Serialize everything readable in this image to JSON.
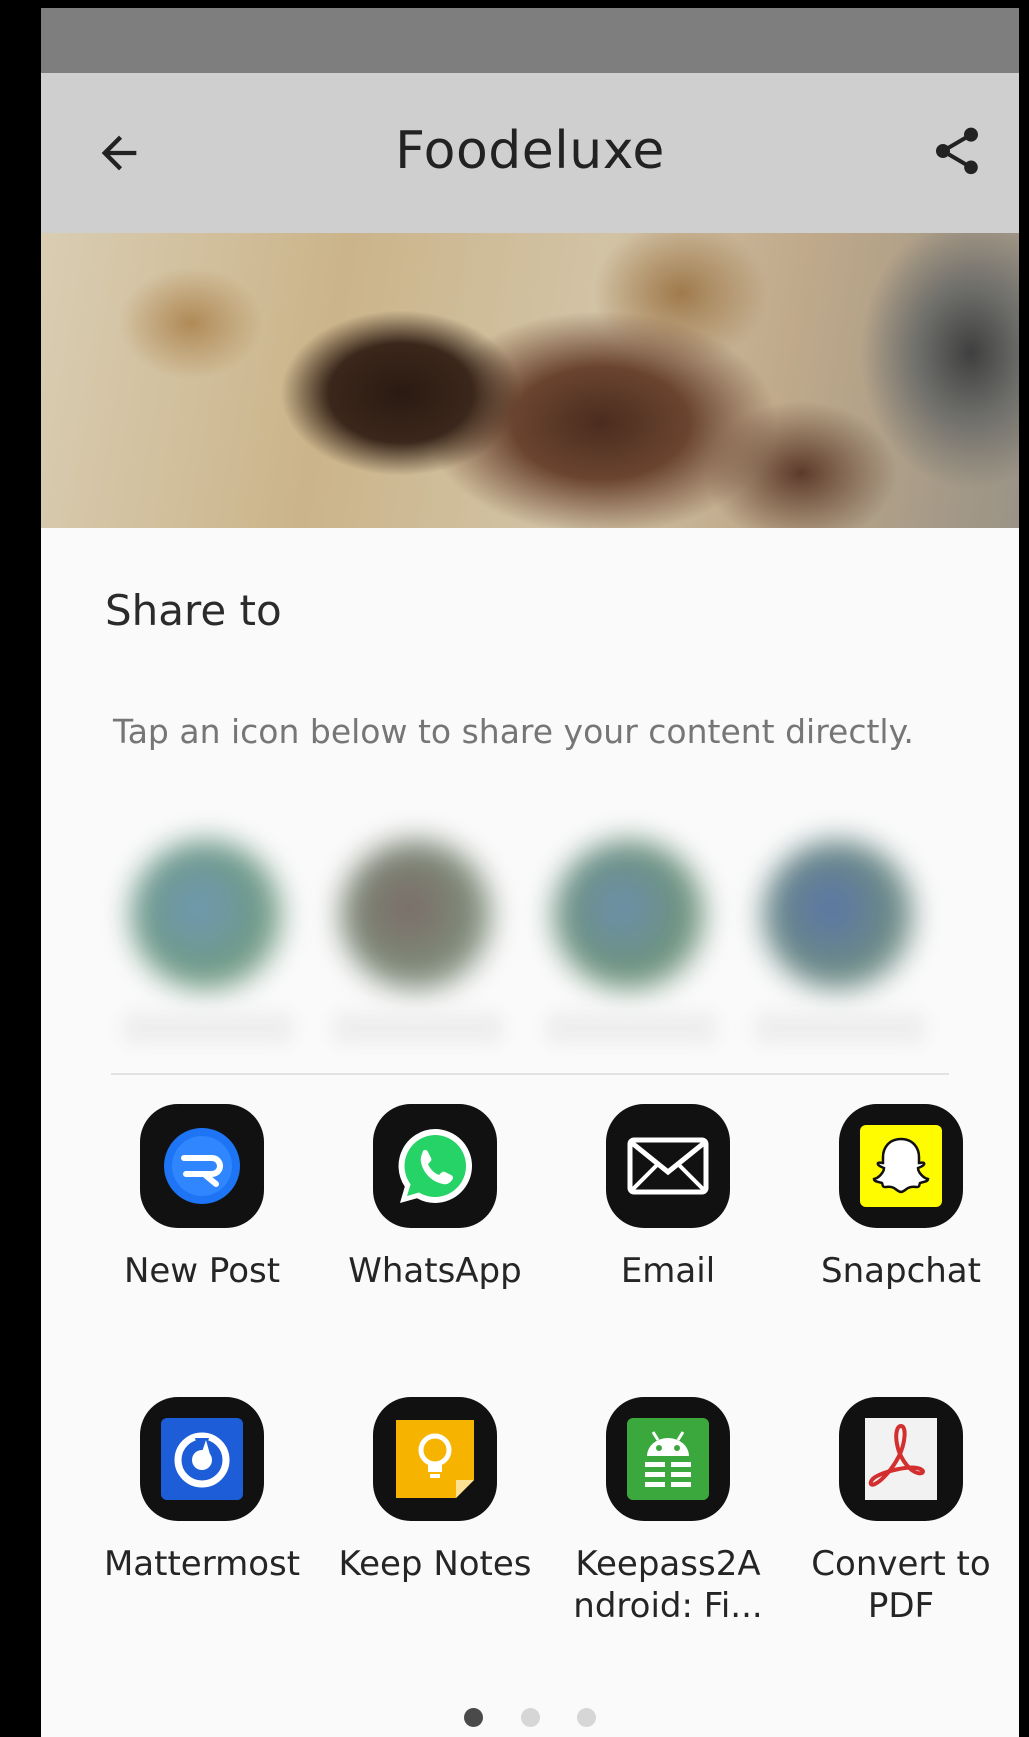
{
  "app_bar": {
    "title": "Foodeluxe",
    "back_icon": "arrow-left-icon",
    "share_icon": "share-icon"
  },
  "share_sheet": {
    "title": "Share to",
    "subtitle": "Tap an icon below to share your content directly.",
    "apps_row1": [
      {
        "label": "New Post",
        "icon": "rocketchat-icon",
        "color": "#1d74f5"
      },
      {
        "label": "WhatsApp",
        "icon": "whatsapp-icon",
        "color": "#25d366"
      },
      {
        "label": "Email",
        "icon": "envelope-icon",
        "color": "#ffffff"
      },
      {
        "label": "Snapchat",
        "icon": "snapchat-ghost-icon",
        "color": "#fffc00"
      }
    ],
    "apps_row2": [
      {
        "label": "Mattermost",
        "icon": "mattermost-icon",
        "color": "#1e5dd8"
      },
      {
        "label": "Keep Notes",
        "icon": "lightbulb-icon",
        "color": "#f6b400"
      },
      {
        "label": "Keepass2A\nndroid: Fi...",
        "icon": "keepass-android-icon",
        "color": "#3aa83d"
      },
      {
        "label": "Convert to\nPDF",
        "icon": "pdf-icon",
        "color": "#d32f2f"
      }
    ],
    "page_indicator": {
      "pages": 3,
      "current": 1
    }
  }
}
